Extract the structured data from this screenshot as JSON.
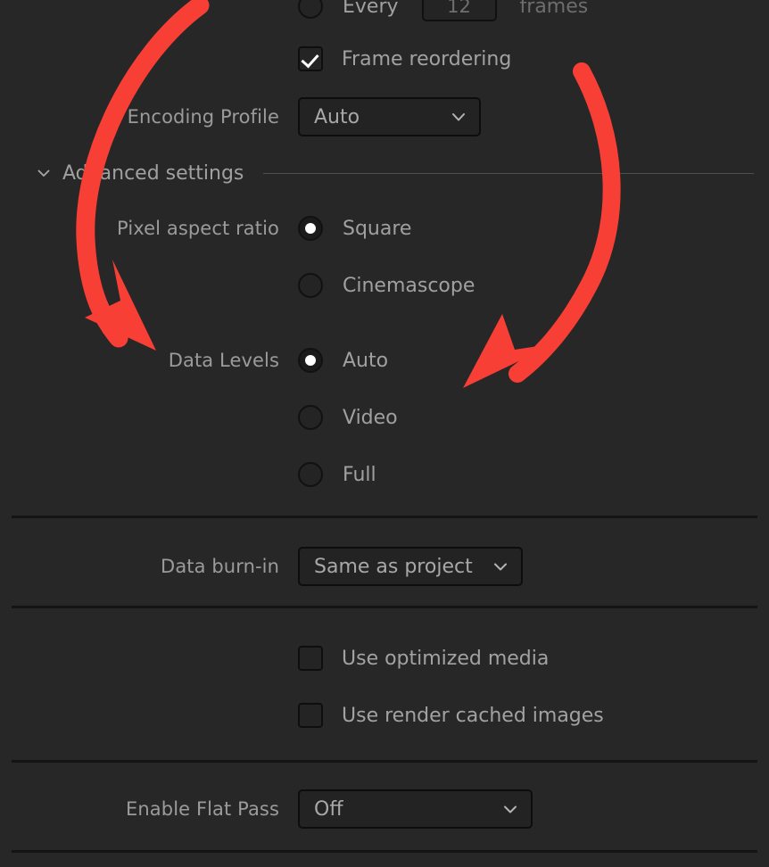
{
  "panel": {
    "background_color": "#272727",
    "text_color": "#9b9b9b",
    "accent_color": "#f73f36"
  },
  "rows": {
    "every_frames": {
      "radio_label": "Every",
      "value": "12",
      "unit": "frames",
      "selected": false
    },
    "frame_reordering": {
      "label": "Frame reordering",
      "checked": true
    },
    "encoding_profile": {
      "label": "Encoding Profile",
      "value": "Auto"
    },
    "advanced_settings": {
      "title": "Advanced settings",
      "chevron": "chevron-down-icon",
      "expanded": true
    },
    "pixel_aspect_ratio": {
      "label": "Pixel aspect ratio",
      "options": [
        {
          "label": "Square",
          "selected": true
        },
        {
          "label": "Cinemascope",
          "selected": false
        }
      ]
    },
    "data_levels": {
      "label": "Data Levels",
      "options": [
        {
          "label": "Auto",
          "selected": true
        },
        {
          "label": "Video",
          "selected": false
        },
        {
          "label": "Full",
          "selected": false
        }
      ]
    },
    "data_burn_in": {
      "label": "Data burn-in",
      "value": "Same as project"
    },
    "use_optimized_media": {
      "label": "Use optimized media",
      "checked": false
    },
    "use_render_cached_images": {
      "label": "Use render cached images",
      "checked": false
    },
    "enable_flat_pass": {
      "label": "Enable Flat Pass",
      "value": "Off"
    }
  },
  "annotations": {
    "arrow_left": {
      "name": "red-curved-arrow-left",
      "points_to": "Data Levels"
    },
    "arrow_right": {
      "name": "red-curved-arrow-right",
      "points_to": "Data Levels radio group"
    }
  }
}
